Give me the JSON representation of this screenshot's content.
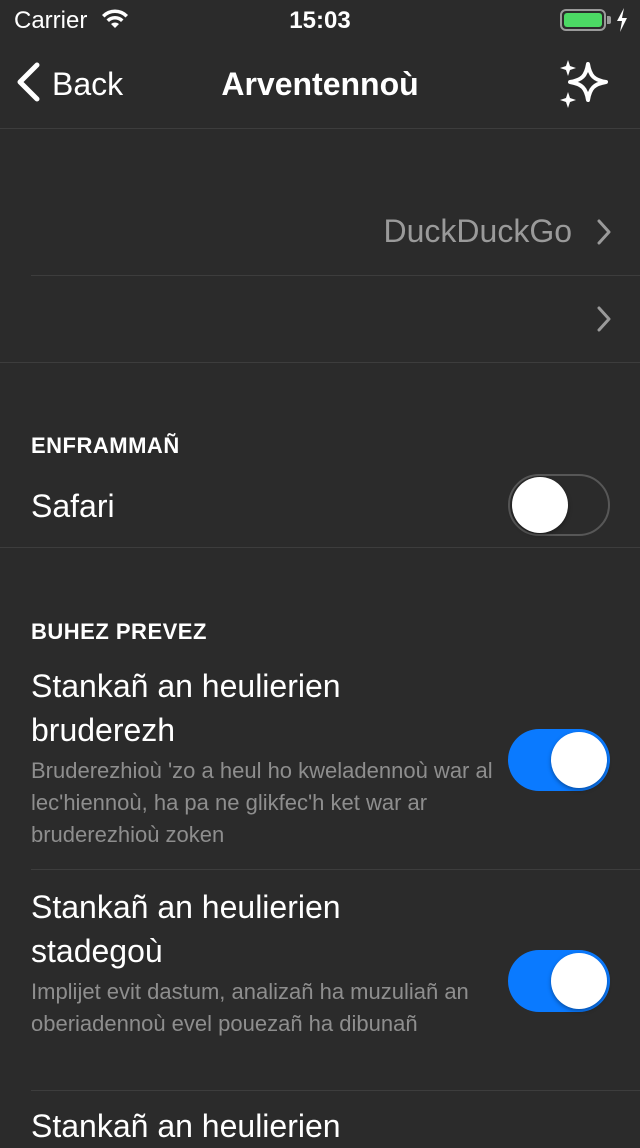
{
  "status_bar": {
    "carrier": "Carrier",
    "time": "15:03",
    "battery_color": "#4cd964"
  },
  "nav": {
    "back_label": "Back",
    "title": "Arventennoù",
    "action_icon": "sparkle-icon"
  },
  "general": {
    "search_engine_value": "DuckDuckGo",
    "second_row_value": ""
  },
  "sections": {
    "embedding": {
      "header": "ENFRAMMAÑ",
      "items": [
        {
          "label": "Safari",
          "enabled": false
        }
      ]
    },
    "privacy": {
      "header": "BUHEZ PREVEZ",
      "items": [
        {
          "label": "Stankañ an heulierien bruderezh",
          "description": "Bruderezhioù 'zo a heul ho kweladennoù war al lec'hiennoù, ha pa ne glikfec'h ket war ar bruderezhioù zoken",
          "enabled": true
        },
        {
          "label": "Stankañ an heulierien stadegoù",
          "description": "Implijet evit dastum, analizañ ha muzuliañ an oberiadennoù evel pouezañ ha dibunañ",
          "enabled": true
        },
        {
          "label": "Stankañ an heulierien"
        }
      ]
    }
  },
  "colors": {
    "background": "#2b2b2b",
    "separator": "#3d3d3d",
    "accent_toggle": "#0a7aff",
    "secondary_text": "#9a9a9a"
  }
}
